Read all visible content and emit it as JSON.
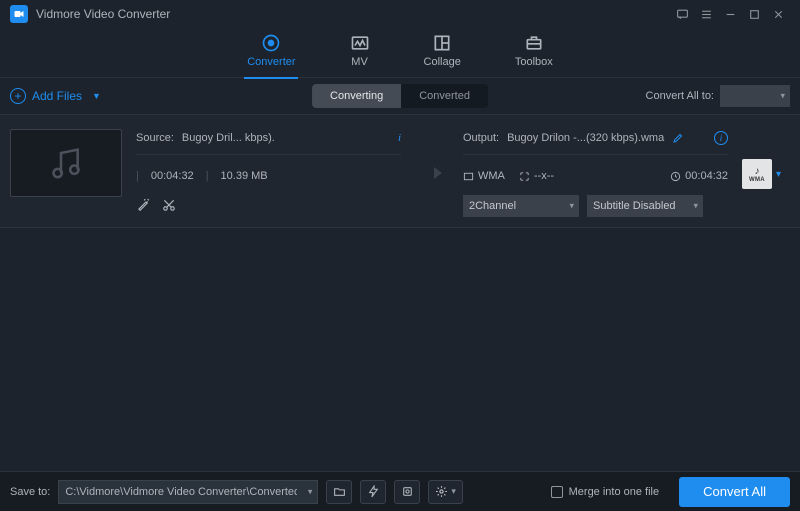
{
  "app_title": "Vidmore Video Converter",
  "nav": {
    "converter": "Converter",
    "mv": "MV",
    "collage": "Collage",
    "toolbox": "Toolbox"
  },
  "toolbar": {
    "add_files": "Add Files",
    "tab_converting": "Converting",
    "tab_converted": "Converted",
    "convert_all_to": "Convert All to:",
    "convert_all_to_value": ""
  },
  "file": {
    "source_label": "Source:",
    "source_name": "Bugoy Dril...  kbps).",
    "duration": "00:04:32",
    "size": "10.39 MB",
    "output_label": "Output:",
    "output_name": "Bugoy Drilon -...(320 kbps).wma",
    "out_format": "WMA",
    "out_res": "--x--",
    "out_duration": "00:04:32",
    "channel": "2Channel",
    "subtitle": "Subtitle Disabled",
    "fmt_ext": "WMA"
  },
  "bottom": {
    "save_to": "Save to:",
    "save_path": "C:\\Vidmore\\Vidmore Video Converter\\Converted",
    "merge": "Merge into one file",
    "convert_all": "Convert All"
  }
}
